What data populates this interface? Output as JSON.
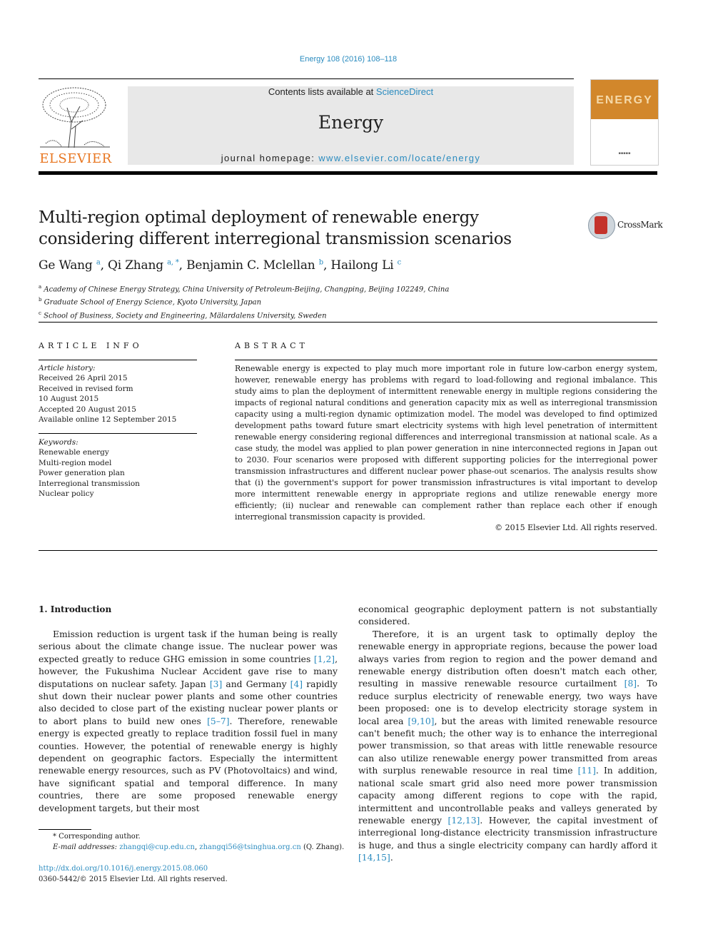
{
  "header": {
    "journal_reference": "Energy 108 (2016) 108–118",
    "contents_prefix": "Contents lists available at ",
    "contents_link": "ScienceDirect",
    "journal_title": "Energy",
    "homepage_prefix": "journal homepage: ",
    "homepage_link": "www.elsevier.com/locate/energy",
    "publisher_logo_text": "ELSEVIER",
    "cover_word": "ENERGY",
    "colors": {
      "link": "#2a8bbf",
      "elsevier_orange": "#e87722",
      "cover_orange": "#d2872b",
      "banner_bg": "#e8e8e8"
    }
  },
  "article": {
    "title": "Multi-region optimal deployment of renewable energy considering different interregional transmission scenarios",
    "crossmark_label": "CrossMark",
    "authors": [
      {
        "name": "Ge Wang",
        "sup": "a"
      },
      {
        "name": "Qi Zhang",
        "sup": "a, *"
      },
      {
        "name": "Benjamin C. Mclellan",
        "sup": "b"
      },
      {
        "name": "Hailong Li",
        "sup": "c"
      }
    ],
    "affiliations": [
      {
        "sup": "a",
        "text": "Academy of Chinese Energy Strategy, China University of Petroleum-Beijing, Changping, Beijing 102249, China"
      },
      {
        "sup": "b",
        "text": "Graduate School of Energy Science, Kyoto University, Japan"
      },
      {
        "sup": "c",
        "text": "School of Business, Society and Engineering, Mälardalens University, Sweden"
      }
    ]
  },
  "article_info": {
    "heading": "ARTICLE INFO",
    "history_label": "Article history:",
    "history": [
      "Received 26 April 2015",
      "Received in revised form",
      "10 August 2015",
      "Accepted 20 August 2015",
      "Available online 12 September 2015"
    ],
    "keywords_label": "Keywords:",
    "keywords": [
      "Renewable energy",
      "Multi-region model",
      "Power generation plan",
      "Interregional transmission",
      "Nuclear policy"
    ]
  },
  "abstract": {
    "heading": "ABSTRACT",
    "text": "Renewable energy is expected to play much more important role in future low-carbon energy system, however, renewable energy has problems with regard to load-following and regional imbalance. This study aims to plan the deployment of intermittent renewable energy in multiple regions considering the impacts of regional natural conditions and generation capacity mix as well as interregional transmission capacity using a multi-region dynamic optimization model. The model was developed to find optimized development paths toward future smart electricity systems with high level penetration of intermittent renewable energy considering regional differences and interregional transmission at national scale. As a case study, the model was applied to plan power generation in nine interconnected regions in Japan out to 2030. Four scenarios were proposed with different supporting policies for the interregional power transmission infrastructures and different nuclear power phase-out scenarios. The analysis results show that (i) the government's support for power transmission infrastructures is vital important to develop more intermittent renewable energy in appropriate regions and utilize renewable energy more efficiently; (ii) nuclear and renewable can complement rather than replace each other if enough interregional transmission capacity is provided.",
    "copyright": "© 2015 Elsevier Ltd. All rights reserved."
  },
  "introduction": {
    "heading": "1.  Introduction",
    "p1": [
      {
        "t": "Emission reduction is urgent task if the human being is really serious about the climate change issue. The nuclear power was expected greatly to reduce GHG emission in some countries "
      },
      {
        "ref": "[1,2]"
      },
      {
        "t": ", however, the Fukushima Nuclear Accident gave rise to many disputations on nuclear safety. Japan "
      },
      {
        "ref": "[3]"
      },
      {
        "t": " and Germany "
      },
      {
        "ref": "[4]"
      },
      {
        "t": " rapidly shut down their nuclear power plants and some other countries also decided to close part of the existing nuclear power plants or to abort plans to build new ones "
      },
      {
        "ref": "[5–7]"
      },
      {
        "t": ". Therefore, renewable energy is expected greatly to replace tradition fossil fuel in many counties. However, the potential of renewable energy is highly dependent on geographic factors. Especially the intermittent renewable energy resources, such as PV (Photovoltaics) and wind, have significant spatial and temporal difference. In many countries, there are some proposed renewable energy development targets, but their most"
      }
    ],
    "p1_cont": "economical geographic deployment pattern is not substantially considered.",
    "p2": [
      {
        "t": "Therefore, it is an urgent task to optimally deploy the renewable energy in appropriate regions, because the power load always varies from region to region and the power demand and renewable energy distribution often doesn't match each other, resulting in massive renewable resource curtailment "
      },
      {
        "ref": "[8]"
      },
      {
        "t": ". To reduce surplus electricity of renewable energy, two ways have been proposed: one is to develop electricity storage system in local area "
      },
      {
        "ref": "[9,10]"
      },
      {
        "t": ", but the areas with limited renewable resource can't benefit much; the other way is to enhance the interregional power transmission, so that areas with little renewable resource can also utilize renewable energy power transmitted from areas with surplus renewable resource in real time "
      },
      {
        "ref": "[11]"
      },
      {
        "t": ". In addition, national scale smart grid also need more power transmission capacity among different regions to cope with the rapid, intermittent and uncontrollable peaks and valleys generated by renewable energy "
      },
      {
        "ref": "[12,13]"
      },
      {
        "t": ". However, the capital investment of interregional long-distance electricity transmission infrastructure is huge, and thus a single electricity company can hardly afford it "
      },
      {
        "ref": "[14,15]"
      },
      {
        "t": "."
      }
    ]
  },
  "footnotes": {
    "corresponding": "* Corresponding author.",
    "email_label": "E-mail addresses:",
    "emails": [
      "zhangqi@cup.edu.cn",
      "zhangqi56@tsinghua.org.cn"
    ],
    "email_suffix": " (Q. Zhang).",
    "doi": "http://dx.doi.org/10.1016/j.energy.2015.08.060",
    "issn": "0360-5442/© 2015 Elsevier Ltd. All rights reserved."
  }
}
